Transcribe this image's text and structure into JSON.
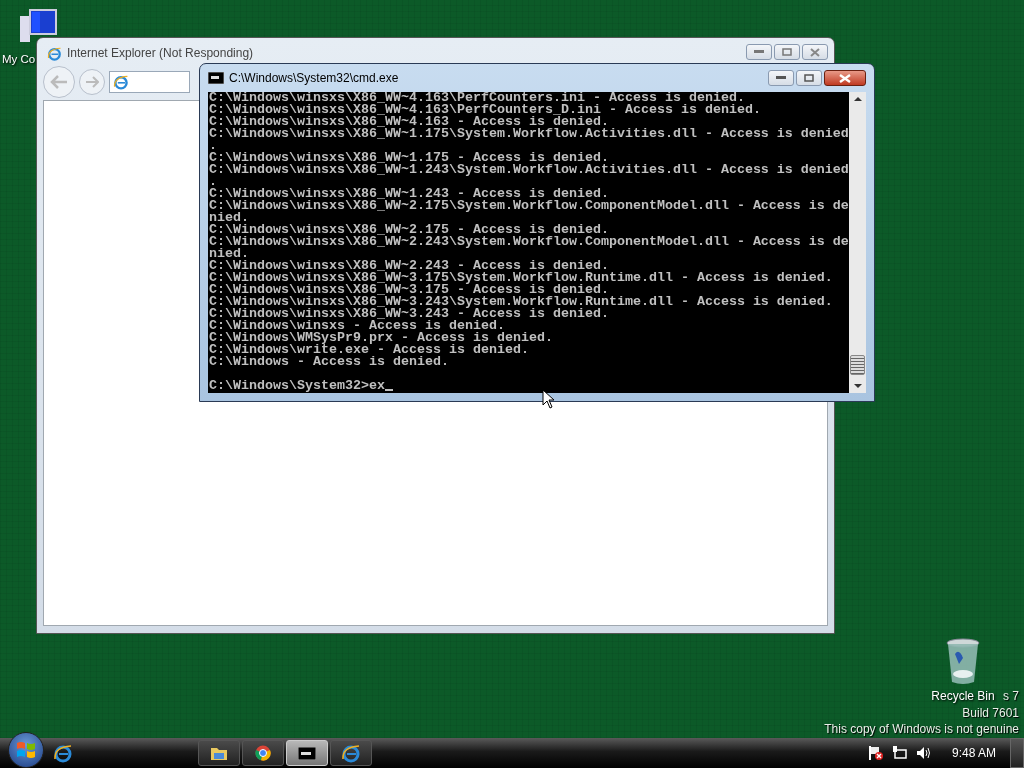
{
  "desktop": {
    "icons": [
      {
        "kind": "computer",
        "label": "My Co"
      },
      {
        "kind": "recycle",
        "label": "Recycle Bin"
      }
    ],
    "watermark": [
      "s 7",
      "Build 7601",
      "This copy of Windows is not genuine"
    ]
  },
  "ie_window": {
    "title": "Internet Explorer (Not Responding)",
    "active": false
  },
  "cmd_window": {
    "title": "C:\\Windows\\System32\\cmd.exe",
    "active": true,
    "output_lines": [
      "C:\\Windows\\winsxs\\X86_WW~4.163\\PerfCounters.ini - Access is denied.",
      "C:\\Windows\\winsxs\\X86_WW~4.163\\PerfCounters_D.ini - Access is denied.",
      "C:\\Windows\\winsxs\\X86_WW~4.163 - Access is denied.",
      "C:\\Windows\\winsxs\\X86_WW~1.175\\System.Workflow.Activities.dll - Access is denied",
      ".",
      "C:\\Windows\\winsxs\\X86_WW~1.175 - Access is denied.",
      "C:\\Windows\\winsxs\\X86_WW~1.243\\System.Workflow.Activities.dll - Access is denied",
      ".",
      "C:\\Windows\\winsxs\\X86_WW~1.243 - Access is denied.",
      "C:\\Windows\\winsxs\\X86_WW~2.175\\System.Workflow.ComponentModel.dll - Access is de",
      "nied.",
      "C:\\Windows\\winsxs\\X86_WW~2.175 - Access is denied.",
      "C:\\Windows\\winsxs\\X86_WW~2.243\\System.Workflow.ComponentModel.dll - Access is de",
      "nied.",
      "C:\\Windows\\winsxs\\X86_WW~2.243 - Access is denied.",
      "C:\\Windows\\winsxs\\X86_WW~3.175\\System.Workflow.Runtime.dll - Access is denied.",
      "C:\\Windows\\winsxs\\X86_WW~3.175 - Access is denied.",
      "C:\\Windows\\winsxs\\X86_WW~3.243\\System.Workflow.Runtime.dll - Access is denied.",
      "C:\\Windows\\winsxs\\X86_WW~3.243 - Access is denied.",
      "C:\\Windows\\winsxs - Access is denied.",
      "C:\\Windows\\WMSysPr9.prx - Access is denied.",
      "C:\\Windows\\write.exe - Access is denied.",
      "C:\\Windows - Access is denied."
    ],
    "prompt": "C:\\Windows\\System32>ex"
  },
  "taskbar": {
    "buttons": [
      {
        "kind": "folder",
        "selected": false
      },
      {
        "kind": "chrome",
        "selected": false
      },
      {
        "kind": "console",
        "selected": true
      },
      {
        "kind": "ie",
        "selected": false
      }
    ],
    "clock": "9:48 AM"
  }
}
